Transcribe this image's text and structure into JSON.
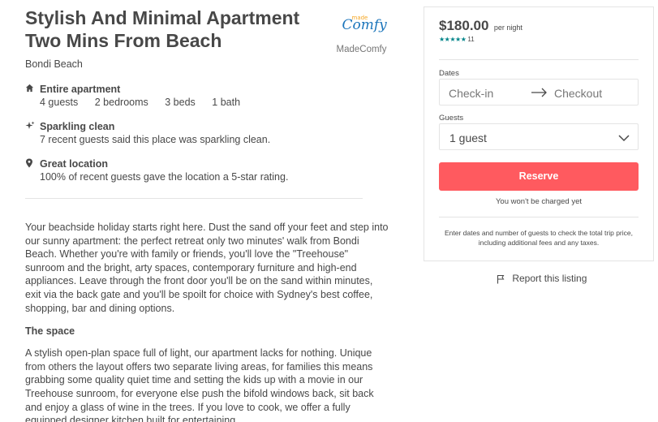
{
  "listing": {
    "title": "Stylish And Minimal Apartment Two Mins From Beach",
    "location": "Bondi Beach"
  },
  "host": {
    "logo_small": "made",
    "logo_big": "Comfy",
    "name": "MadeComfy"
  },
  "highlights": [
    {
      "icon": "home-icon",
      "title": "Entire apartment",
      "details": [
        "4 guests",
        "2 bedrooms",
        "3 beds",
        "1 bath"
      ]
    },
    {
      "icon": "sparkle-icon",
      "title": "Sparkling clean",
      "text": "7 recent guests said this place was sparkling clean."
    },
    {
      "icon": "location-pin-icon",
      "title": "Great location",
      "text": "100% of recent guests gave the location a 5-star rating."
    }
  ],
  "description": "Your beachside holiday starts right here. Dust the sand off your feet and step into our sunny apartment: the perfect retreat only two minutes' walk from Bondi Beach. Whether you're with family or friends, you'll love the \"Treehouse\" sunroom and the bright, arty spaces, contemporary furniture and high-end appliances. Leave through the front door you'll be on the sand within minutes, exit via the back gate and you'll be spoilt for choice with Sydney's best coffee, shopping, bar and dining options.",
  "space": {
    "title": "The space",
    "text": "A stylish open-plan space full of light, our apartment lacks for nothing. Unique from others the layout offers two separate living areas, for families this means grabbing some quality quiet time and setting the kids up with a movie in our Treehouse sunroom, for everyone else push the bifold windows back, sit back and enjoy a glass of wine in the trees. If you love to cook, we offer a fully equipped designer kitchen built for entertaining."
  },
  "booking": {
    "price": "$180.00",
    "price_unit": "per night",
    "stars": "★★★★★",
    "rating_value": 5,
    "review_count": "11",
    "dates_label": "Dates",
    "checkin_placeholder": "Check-in",
    "checkout_placeholder": "Checkout",
    "guests_label": "Guests",
    "guests_value": "1 guest",
    "reserve_label": "Reserve",
    "not_charged": "You won't be charged yet",
    "note": "Enter dates and number of guests to check the total trip price, including additional fees and any taxes.",
    "accent_color": "#ff5a5f",
    "star_color": "#008489"
  },
  "report": {
    "label": "Report this listing"
  }
}
